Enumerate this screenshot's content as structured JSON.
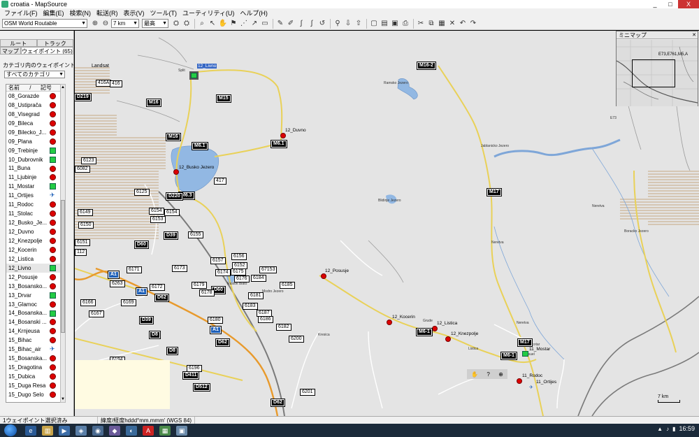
{
  "window": {
    "title": "croatia - MapSource",
    "controls": [
      "_",
      "□",
      "X"
    ]
  },
  "menu": [
    "ファイル(F)",
    "編集(E)",
    "検索(N)",
    "転送(R)",
    "表示(V)",
    "ツール(T)",
    "ユーティリティ(U)",
    "ヘルプ(H)"
  ],
  "toolbar": {
    "map_product": "OSM World Routable",
    "zoom": "7 km",
    "detail": "最高"
  },
  "left_panel": {
    "tabs_row1": [
      "ルート",
      "トラック"
    ],
    "tabs_row2": [
      "マップ",
      "ウェイポイント (65)"
    ],
    "filter_label": "カテゴリ内のウェイポイントの表",
    "category": "すべてのカテゴリ",
    "column_name": "名前",
    "column_sort": "/",
    "column_symbol": "記号",
    "waypoints": [
      {
        "name": "08_Gorazde",
        "symbol": "red-pin"
      },
      {
        "name": "08_Ustiprača",
        "symbol": "red-pin"
      },
      {
        "name": "08_Visegrad",
        "symbol": "red-pin"
      },
      {
        "name": "09_Bileca",
        "symbol": "red-pin"
      },
      {
        "name": "09_Bilecko_J...",
        "symbol": "red-pin"
      },
      {
        "name": "09_Plana",
        "symbol": "red-pin"
      },
      {
        "name": "09_Trebinje",
        "symbol": "green-flag"
      },
      {
        "name": "10_Dubrovnik",
        "symbol": "green-flag"
      },
      {
        "name": "11_Buna",
        "symbol": "red-pin"
      },
      {
        "name": "11_Ljubinje",
        "symbol": "red-pin"
      },
      {
        "name": "11_Mostar",
        "symbol": "green-flag"
      },
      {
        "name": "11_Ortijes",
        "symbol": "airplane"
      },
      {
        "name": "11_Rodoc",
        "symbol": "red-pin"
      },
      {
        "name": "11_Stolac",
        "symbol": "red-pin"
      },
      {
        "name": "12_Busko_Je...",
        "symbol": "red-pin"
      },
      {
        "name": "12_Duvno",
        "symbol": "red-pin"
      },
      {
        "name": "12_Knezpolje",
        "symbol": "red-pin"
      },
      {
        "name": "12_Kocerin",
        "symbol": "red-pin"
      },
      {
        "name": "12_Listica",
        "symbol": "red-pin"
      },
      {
        "name": "12_Livno",
        "symbol": "green-flag"
      },
      {
        "name": "12_Posusje",
        "symbol": "red-pin"
      },
      {
        "name": "13_Bosansko...",
        "symbol": "red-pin"
      },
      {
        "name": "13_Drvar",
        "symbol": "green-flag"
      },
      {
        "name": "13_Glamoc",
        "symbol": "red-pin"
      },
      {
        "name": "14_Bosanska...",
        "symbol": "green-flag"
      },
      {
        "name": "14_Bosanski ...",
        "symbol": "red-pin"
      },
      {
        "name": "14_Krnjeusa",
        "symbol": "red-pin"
      },
      {
        "name": "15_Bihac",
        "symbol": "red-pin"
      },
      {
        "name": "15_Bihac_air",
        "symbol": "airplane"
      },
      {
        "name": "15_Bosanska...",
        "symbol": "red-pin"
      },
      {
        "name": "15_Dragotina",
        "symbol": "red-pin"
      },
      {
        "name": "15_Dubica",
        "symbol": "red-pin"
      },
      {
        "name": "15_Duga Resa",
        "symbol": "red-pin"
      },
      {
        "name": "15_Dugo Selo",
        "symbol": "red-pin"
      }
    ],
    "selected_index": 19
  },
  "map": {
    "places": {
      "landsat": "Landsat",
      "split": "Split",
      "ramsko": "Ramsko Jezero",
      "jablanicko": "Jablanicko Jezero",
      "blidinje": "Blidinje Jezero",
      "bor": "Boracko Jezero",
      "kresica": "Kresica",
      "nervo": "Neretva",
      "nervo2": "Neretva",
      "nervo3": "Neretva",
      "grude": "Grude",
      "lista": "Listica",
      "e73": "E73",
      "mostar_s": "Mostar",
      "usuel": "Usuel",
      "blato": "Rastok Blato",
      "modro": "Modro Jezero"
    },
    "waypoints": {
      "livno": "12_Livno",
      "duvno": "12_Duvno",
      "busko": "12_Busko Jezero",
      "posusje": "12_Posusje",
      "kocerin": "12_Kocerin",
      "listica": "12_Listica",
      "knezpolje": "12_Knezpolje",
      "mostar": "11_Mostar",
      "rodoc": "11_Rodoc",
      "ortijes": "11_Ortijes"
    },
    "roads": {
      "r_m16_2": "M16-2",
      "r_m16a": "M16",
      "r_m15": "M15",
      "r_m16b": "M16",
      "r_m61a": "M6.1",
      "r_m61b": "M6.1",
      "r_m63": "M6.3",
      "r_d220": "D220",
      "r_m17a": "M17",
      "r_m17b": "M17",
      "r_m61c": "M6-1",
      "r_m61d": "M6-1",
      "r_d219": "D219",
      "r_d60": "D60",
      "r_d39a": "D39",
      "r_d39b": "D39",
      "r_d8a": "D8",
      "r_d8b": "D8",
      "r_d62a": "D62",
      "r_d62b": "D62",
      "r_d62c": "D62",
      "r_d411": "D411",
      "r_d512": "D512",
      "r_d60b": "D60",
      "r_a1a": "A1",
      "r_a1b": "A1",
      "r_a1c": "A1",
      "r_416a": "416A",
      "r_416": "416",
      "r_6082": "6082",
      "r_6123": "6123",
      "r_6125": "6125",
      "r_6149": "6149",
      "r_6150": "6150",
      "r_6151": "6151",
      "r_6154": "6154",
      "r_6153": "6153",
      "r_6155": "6155",
      "r_6156": "6156",
      "r_6157": "6157",
      "r_6171": "6171",
      "r_6173": "6173",
      "r_6172": "6172",
      "r_6174": "6174",
      "r_6175": "6175",
      "r_6176": "6176",
      "r_6178": "6178",
      "r_6179": "6179",
      "r_6181": "6181",
      "r_6183": "6183",
      "r_6184": "6184",
      "r_6185": "6185",
      "r_6186": "6186",
      "r_6187": "6187",
      "r_6180": "6180",
      "r_6182": "6182",
      "r_6200": "6200",
      "r_6201": "6201",
      "r_6166": "6166",
      "r_6169": "6169",
      "r_6167": "6167",
      "r_6263": "6263",
      "r_6194": "6194",
      "r_6196": "6196",
      "r_6152": "6152",
      "r_67153": "67153",
      "r_417": "417",
      "r_112": "112"
    },
    "minimap_title": "ミニマップ",
    "minimap_label": "E73,E761,M5,A",
    "scale": "7 km"
  },
  "status": {
    "selection": "1ウェイポイント選択済み",
    "coords": "緯度/経度hddd°mm.mmm' (WGS 84)"
  },
  "taskbar": {
    "clock": "16:59"
  }
}
